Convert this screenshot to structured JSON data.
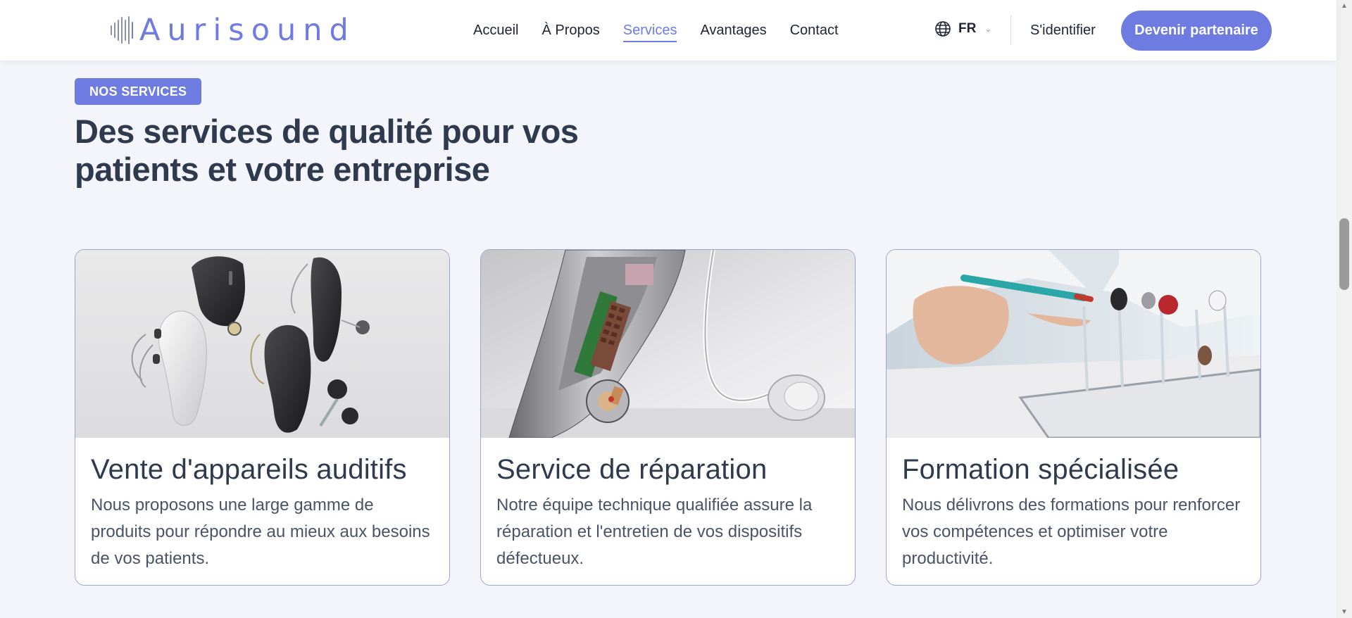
{
  "header": {
    "logo_text": "Aurisound",
    "nav": [
      {
        "label": "Accueil"
      },
      {
        "label": "À Propos"
      },
      {
        "label": "Services"
      },
      {
        "label": "Avantages"
      },
      {
        "label": "Contact"
      }
    ],
    "active_nav": "Services",
    "language": "FR",
    "login_label": "S'identifier",
    "cta_label": "Devenir partenaire"
  },
  "section": {
    "badge": "NOS SERVICES",
    "heading_line1": "Des services de qualité pour vos",
    "heading_line2": "patients et votre entreprise"
  },
  "cards": [
    {
      "title": "Vente d'appareils auditifs",
      "description": "Nous proposons une large gamme de produits pour répondre au mieux aux besoins de vos patients.",
      "image": "hearing-aids-product-photo"
    },
    {
      "title": "Service de réparation",
      "description": "Notre équipe technique qualifiée assure la réparation et l'entretien de vos dispositifs défectueux.",
      "image": "hearing-aid-cutaway-photo"
    },
    {
      "title": "Formation spécialisée",
      "description": "Nous délivrons des formations pour renforcer vos compétences et optimiser votre productivité.",
      "image": "technician-training-photo"
    }
  ],
  "colors": {
    "accent": "#6e7be0",
    "text": "#2f3a4f",
    "background": "#f3f5fa"
  }
}
